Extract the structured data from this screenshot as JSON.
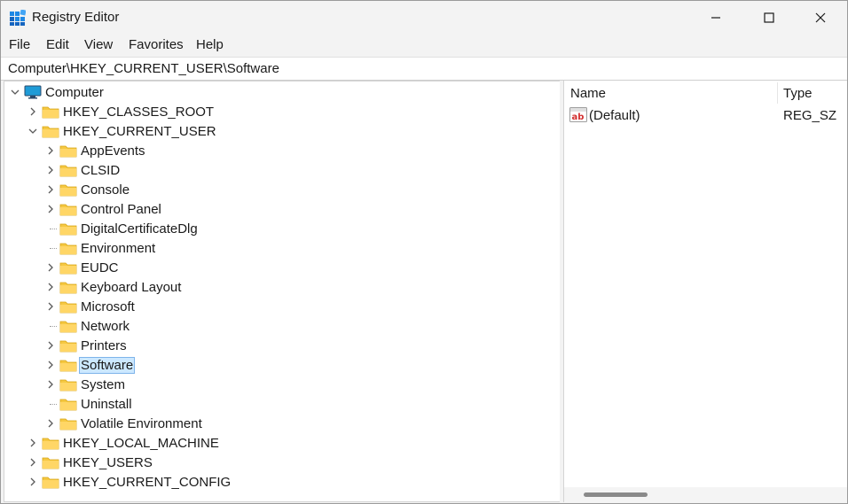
{
  "window": {
    "title": "Registry Editor"
  },
  "icons": {
    "app": "registry-icon",
    "minimize": "minimize-icon",
    "maximize": "maximize-icon",
    "close": "close-icon",
    "folder": "folder-icon",
    "computer": "computer-icon",
    "string_value": "string-value-icon"
  },
  "colors": {
    "folder": "#f5c842",
    "selection": "#cce8ff",
    "selection_border": "#7eb4ea"
  },
  "menu": [
    "File",
    "Edit",
    "View",
    "Favorites",
    "Help"
  ],
  "address": "Computer\\HKEY_CURRENT_USER\\Software",
  "tree": [
    {
      "label": "Computer",
      "level": 0,
      "expander": "expanded",
      "icon": "computer"
    },
    {
      "label": "HKEY_CLASSES_ROOT",
      "level": 1,
      "expander": "collapsed"
    },
    {
      "label": "HKEY_CURRENT_USER",
      "level": 1,
      "expander": "expanded"
    },
    {
      "label": "AppEvents",
      "level": 2,
      "expander": "collapsed"
    },
    {
      "label": "CLSID",
      "level": 2,
      "expander": "collapsed"
    },
    {
      "label": "Console",
      "level": 2,
      "expander": "collapsed"
    },
    {
      "label": "Control Panel",
      "level": 2,
      "expander": "collapsed"
    },
    {
      "label": "DigitalCertificateDlg",
      "level": 2,
      "expander": "none"
    },
    {
      "label": "Environment",
      "level": 2,
      "expander": "none"
    },
    {
      "label": "EUDC",
      "level": 2,
      "expander": "collapsed"
    },
    {
      "label": "Keyboard Layout",
      "level": 2,
      "expander": "collapsed"
    },
    {
      "label": "Microsoft",
      "level": 2,
      "expander": "collapsed"
    },
    {
      "label": "Network",
      "level": 2,
      "expander": "none"
    },
    {
      "label": "Printers",
      "level": 2,
      "expander": "collapsed"
    },
    {
      "label": "Software",
      "level": 2,
      "expander": "collapsed",
      "selected": true
    },
    {
      "label": "System",
      "level": 2,
      "expander": "collapsed"
    },
    {
      "label": "Uninstall",
      "level": 2,
      "expander": "none"
    },
    {
      "label": "Volatile Environment",
      "level": 2,
      "expander": "collapsed"
    },
    {
      "label": "HKEY_LOCAL_MACHINE",
      "level": 1,
      "expander": "collapsed"
    },
    {
      "label": "HKEY_USERS",
      "level": 1,
      "expander": "collapsed"
    },
    {
      "label": "HKEY_CURRENT_CONFIG",
      "level": 1,
      "expander": "collapsed"
    }
  ],
  "list": {
    "columns": {
      "name": "Name",
      "type": "Type"
    },
    "rows": [
      {
        "name": "(Default)",
        "type": "REG_SZ",
        "icon": "string_value"
      }
    ]
  }
}
